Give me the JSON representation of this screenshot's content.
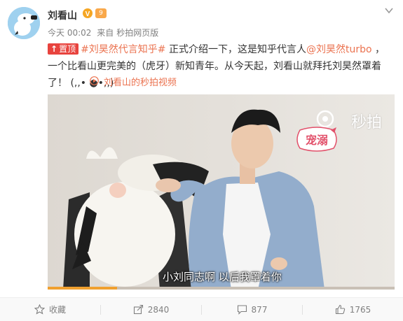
{
  "user": {
    "name": "刘看山",
    "verified_badge": "V",
    "level_badge": "9"
  },
  "meta": {
    "time": "今天 00:02",
    "source_prefix": "来自",
    "source": "秒拍网页版"
  },
  "post": {
    "pin_label": "置顶",
    "topic": "#刘昊然代言知乎#",
    "text_1": " 正式介绍一下，这是知乎代言人",
    "mention": "@刘昊然turbo",
    "text_2": " ，一个比看山更完美的（虎牙）新知青年。从今天起，刘看山就拜托刘昊然罩着了！ (,,• ●•,,)"
  },
  "video_link": {
    "label": "刘看山的秒拍视频",
    "icon": "play-circle-icon"
  },
  "video": {
    "watermark": "秒拍",
    "sticker": "宠溺",
    "subtitle": "小刘同志啊 以后我罩着你",
    "progress": 0.2
  },
  "actions": [
    {
      "icon": "star-icon",
      "label": "收藏"
    },
    {
      "icon": "share-icon",
      "label": "2840"
    },
    {
      "icon": "comment-icon",
      "label": "877"
    },
    {
      "icon": "thumbs-up-icon",
      "label": "1765"
    }
  ],
  "colors": {
    "accent": "#eb7350",
    "pin": "#e8433e",
    "verified": "#f5a623"
  }
}
